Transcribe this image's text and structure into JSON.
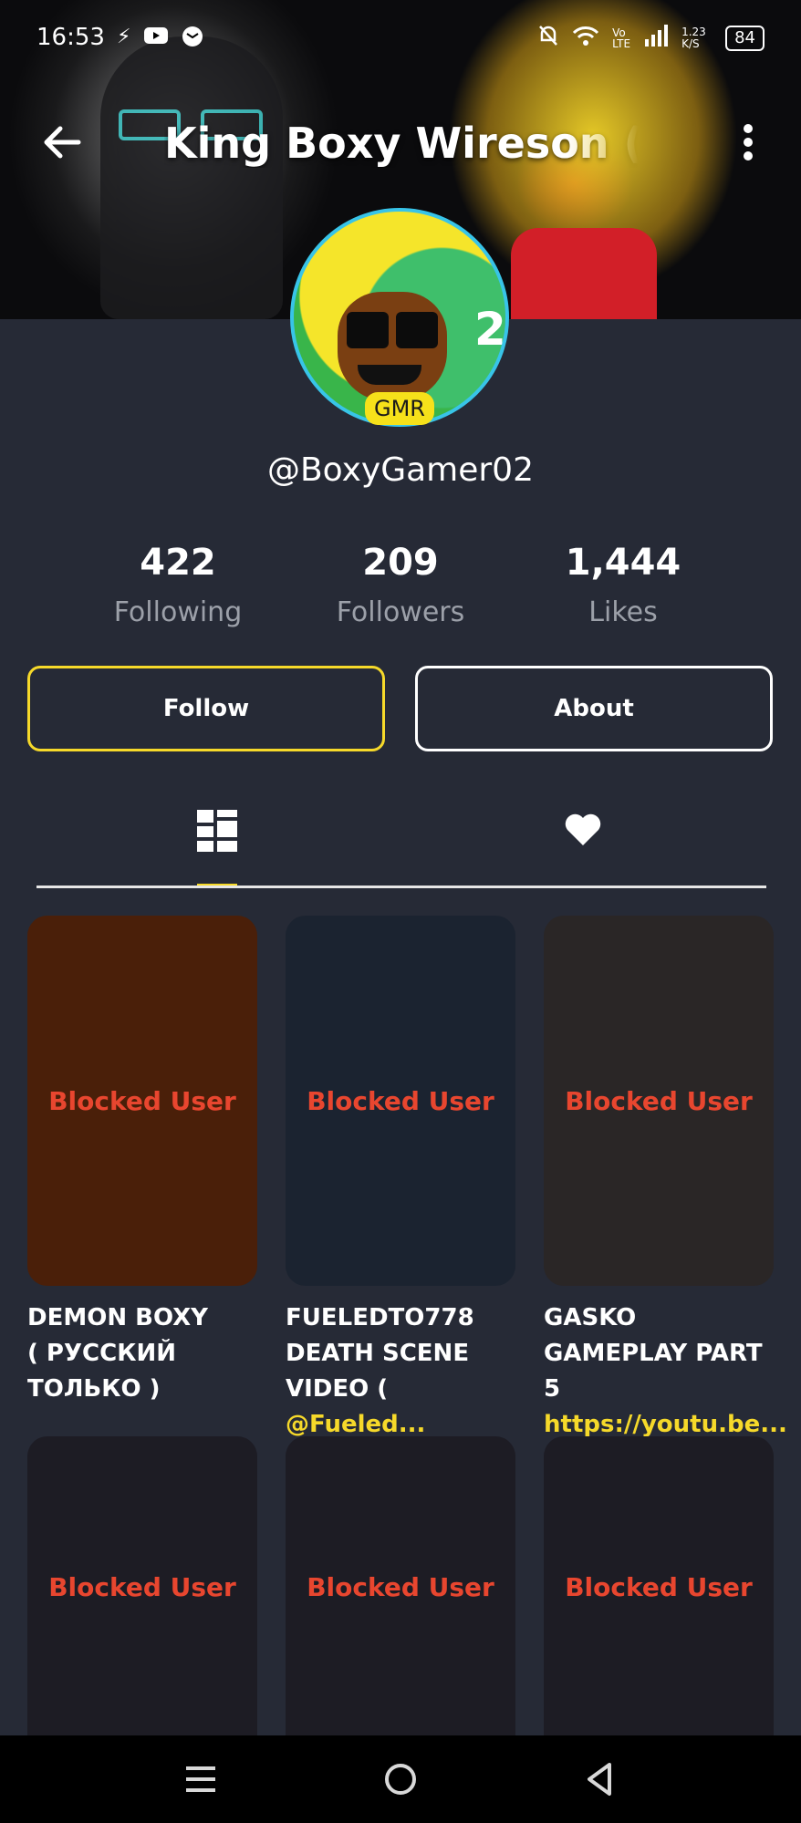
{
  "status_bar": {
    "time": "16:53",
    "left_icons": [
      "charging-bolt-icon",
      "youtube-icon",
      "message-icon"
    ],
    "right_icons": [
      "mute-bell-icon",
      "wifi-icon",
      "volte-icon",
      "signal-icon"
    ],
    "network_speed": "1.23 K/S",
    "battery": "84"
  },
  "header": {
    "title": "King Boxy Wireson ( Ko"
  },
  "profile": {
    "avatar_badge": "GMR",
    "avatar_number": "2",
    "username": "@BoxyGamer02",
    "stats": [
      {
        "value": "422",
        "label": "Following"
      },
      {
        "value": "209",
        "label": "Followers"
      },
      {
        "value": "1,444",
        "label": "Likes"
      }
    ],
    "follow_label": "Follow",
    "about_label": "About"
  },
  "tabs": {
    "active": "videos",
    "icons": [
      "grid-icon",
      "heart-icon"
    ]
  },
  "videos": [
    {
      "overlay": "Blocked User",
      "bg": "#4a1f09",
      "title_lines": [
        "DEMON BOXY",
        "( РУССКИЙ",
        "ТОЛЬКО )"
      ],
      "link": ""
    },
    {
      "overlay": "Blocked User",
      "bg": "#1b2330",
      "title_lines": [
        "FUELEDTO778",
        "DEATH SCENE",
        "VIDEO ( "
      ],
      "link": "@Fueled..."
    },
    {
      "overlay": "Blocked User",
      "bg": "#2a2626",
      "title_lines": [
        "GASKO",
        "GAMEPLAY PART",
        "5 "
      ],
      "link": "https://youtu.be..."
    },
    {
      "overlay": "Blocked User",
      "bg": "#1d1c24"
    },
    {
      "overlay": "Blocked User",
      "bg": "#1d1c24"
    },
    {
      "overlay": "Blocked User",
      "bg": "#1d1c24"
    }
  ],
  "colors": {
    "accent": "#f6d92a",
    "background": "#262a36",
    "blocked_text": "#e8462f"
  }
}
